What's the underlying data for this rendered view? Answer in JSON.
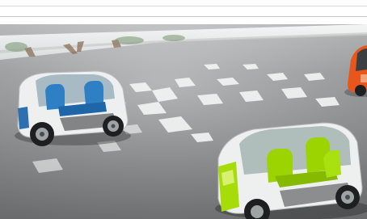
{
  "image": {
    "subject": "two-seat-autonomous-pod-cars",
    "cars": [
      {
        "name": "blue-interior-car",
        "accent": "#2f7fc4"
      },
      {
        "name": "lime-green-interior-car",
        "accent": "#9bd400"
      },
      {
        "name": "orange-car-partial",
        "accent": "#e8561c"
      }
    ],
    "colors": {
      "floor": "#8f9092",
      "floor_light": "#b0b1b2",
      "window_band": "#e9ecec",
      "body_white": "#eef0f0",
      "tire": "#1e1f21"
    }
  }
}
